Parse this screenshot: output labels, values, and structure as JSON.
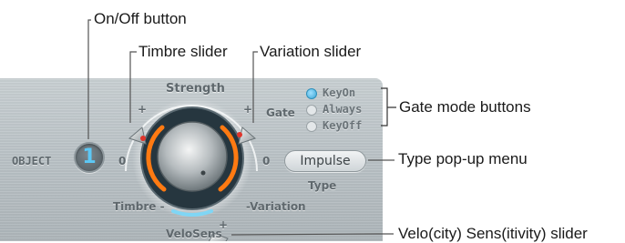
{
  "callouts": {
    "on_off": "On/Off button",
    "timbre_slider": "Timbre slider",
    "variation_slider": "Variation slider",
    "gate_mode": "Gate mode buttons",
    "type_menu": "Type pop-up menu",
    "velo_sens": "Velo(city) Sens(itivity) slider"
  },
  "panel": {
    "strength_label": "Strength",
    "object_label": "OBJECT",
    "object_number": "1",
    "timbre_label": "Timbre -",
    "variation_label": "-Variation",
    "velosens_label": "VeloSens",
    "left_zero": "0",
    "right_zero": "0",
    "timbre_plus": "+",
    "variation_plus": "+",
    "velo_plus": "+",
    "gate_label": "Gate",
    "gate_options": [
      "KeyOn",
      "Always",
      "KeyOff"
    ],
    "gate_selected": "KeyOn",
    "type_value": "Impulse",
    "type_label": "Type"
  },
  "colors": {
    "accent_orange": "#ff7a12",
    "led_blue": "#5cc8f5",
    "velo_blue": "#7fd6f5",
    "slider_red": "#e0342b"
  }
}
